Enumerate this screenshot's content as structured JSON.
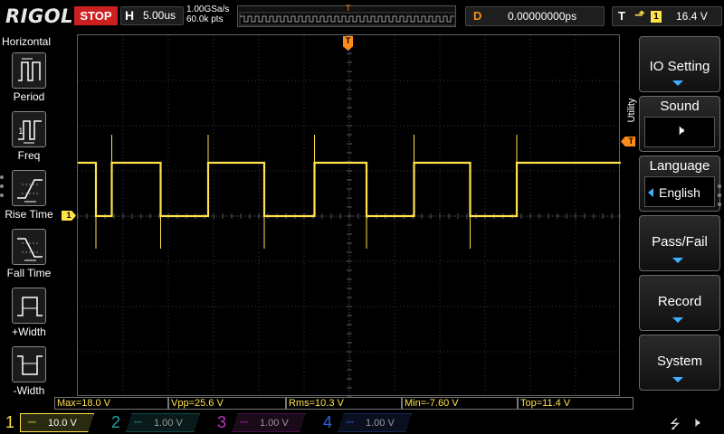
{
  "header": {
    "brand": "RIGOL",
    "run_state": "STOP",
    "timebase": {
      "label": "H",
      "value": "5.00us"
    },
    "sampling": {
      "rate": "1.00GSa/s",
      "points": "60.0k pts"
    },
    "delay": {
      "label": "D",
      "value": "0.00000000ps"
    },
    "trigger": {
      "label": "T",
      "edge_symbol": "⬏",
      "source": "1",
      "level": "16.4 V"
    },
    "trigger_marker": "T"
  },
  "left_menu": {
    "title": "Horizontal",
    "items": [
      {
        "label": "Period",
        "icon": "period-icon"
      },
      {
        "label": "Freq",
        "icon": "frequency-icon"
      },
      {
        "label": "Rise Time",
        "icon": "rise-time-icon"
      },
      {
        "label": "Fall Time",
        "icon": "fall-time-icon"
      },
      {
        "label": "+Width",
        "icon": "positive-width-icon"
      },
      {
        "label": "-Width",
        "icon": "negative-width-icon"
      }
    ]
  },
  "markers": {
    "ch1": "1",
    "trigger_level": "T",
    "trigger_time": "T"
  },
  "measurements": [
    {
      "text": "Max=18.0 V"
    },
    {
      "text": "Vpp=25.6 V"
    },
    {
      "text": "Rms=10.3 V"
    },
    {
      "text": "Min=-7.60 V"
    },
    {
      "text": "Top=11.4 V"
    }
  ],
  "right_menu": {
    "tab_label": "Utility",
    "buttons": [
      {
        "label": "IO Setting",
        "has_arrow": true
      },
      {
        "label": "Sound",
        "sub_value": "🕨"
      },
      {
        "label": "Language",
        "sub_value": "English"
      },
      {
        "label": "Pass/Fail",
        "has_arrow": true
      },
      {
        "label": "Record",
        "has_arrow": true
      },
      {
        "label": "System",
        "has_arrow": true
      }
    ]
  },
  "channels": [
    {
      "number": "1",
      "coupling": "⎓",
      "scale": "10.0 V",
      "active": true,
      "color": "#ffe24a"
    },
    {
      "number": "2",
      "coupling": "⎓",
      "scale": "1.00 V",
      "active": false,
      "color": "#1fa3a3"
    },
    {
      "number": "3",
      "coupling": "⎓",
      "scale": "1.00 V",
      "active": false,
      "color": "#c030c0"
    },
    {
      "number": "4",
      "coupling": "⎓",
      "scale": "1.00 V",
      "active": false,
      "color": "#3060e0"
    }
  ],
  "status_icons": {
    "usb": "⭍",
    "speaker": "🕨"
  },
  "colors": {
    "ch1_trace": "#ffe24a",
    "trigger": "#ff8c1a",
    "stop": "#cc1f1f",
    "accent_blue": "#3fb0ff"
  },
  "trace": {
    "channel": "1",
    "waveform": "square",
    "high_level": "Top=11.4 V",
    "pulse_edges_div": [
      [
        0.0,
        0.35
      ],
      [
        1.43,
        2.48
      ],
      [
        3.72,
        4.83
      ],
      [
        5.98,
        7.03
      ],
      [
        8.27,
        9.3
      ]
    ]
  }
}
